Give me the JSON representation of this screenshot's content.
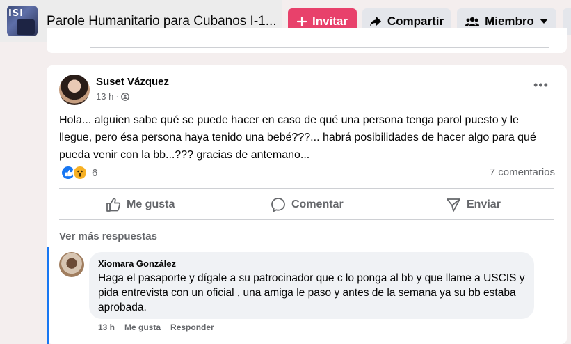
{
  "header": {
    "group_thumb_text": "ISI",
    "group_title": "Parole Humanitario para Cubanos I-1...",
    "invite_label": "Invitar",
    "share_label": "Compartir",
    "member_label": "Miembro",
    "accent_color": "#e8416b"
  },
  "post": {
    "author": "Suset Vázquez",
    "time": "13 h",
    "privacy_icon": "group-globe-icon",
    "text": "Hola... alguien sabe qué se puede hacer en caso de qué una persona tenga parol puesto y le llegue, pero ésa persona haya tenido una bebé???... habrá posibilidades de hacer algo para qué pueda venir con la bb...??? gracias de antemano...",
    "reaction_count": "6",
    "comments_count": "7 comentarios",
    "actions": {
      "like": "Me gusta",
      "comment": "Comentar",
      "send": "Enviar"
    },
    "see_more": "Ver más respuestas"
  },
  "comment": {
    "author": "Xiomara González",
    "text": "Haga el pasaporte y dígale a su patrocinador que c lo ponga al bb y que llame a USCIS y pida entrevista con un oficial , una amiga le paso y antes de la semana ya su bb estaba aprobada.",
    "time": "13 h",
    "like": "Me gusta",
    "reply": "Responder"
  }
}
